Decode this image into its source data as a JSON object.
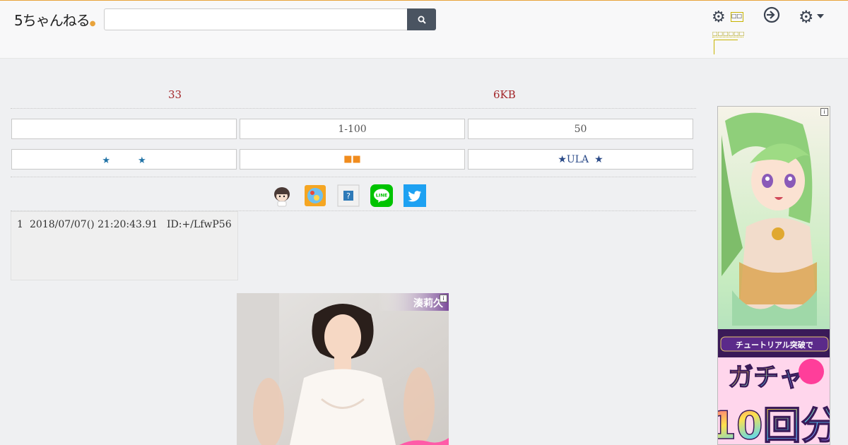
{
  "header": {
    "logo_text": "5ちゃんねる",
    "search_placeholder": "",
    "gear_label": "□□",
    "gear_sub": "□□□□□□"
  },
  "stats": {
    "count": "33",
    "size": "6KB"
  },
  "nav_row1": [
    "",
    "1-100",
    "50"
  ],
  "nav_row2": {
    "left": "★　　　★",
    "center": "■■",
    "right_star1": "★",
    "right_text": "ULA",
    "right_star2": "★"
  },
  "share": [
    "avatar-icon",
    "bookmark-icon",
    "help-icon",
    "line-icon",
    "twitter-icon"
  ],
  "post": {
    "number": "1",
    "datetime": "2018/07/07() 21:20:43.91",
    "id": "ID:+/LfwP56"
  },
  "ads": {
    "ad1_name": "湊莉久",
    "ad1_badge": "i",
    "ad2_banner": "チュートリアル突破で",
    "ad2_line1": "ガチャ",
    "ad2_line2": "10回分",
    "ad2_badge": "i"
  },
  "colors": {
    "accent": "#e8a33b",
    "red": "#a3262a",
    "button": "#4a5461"
  }
}
